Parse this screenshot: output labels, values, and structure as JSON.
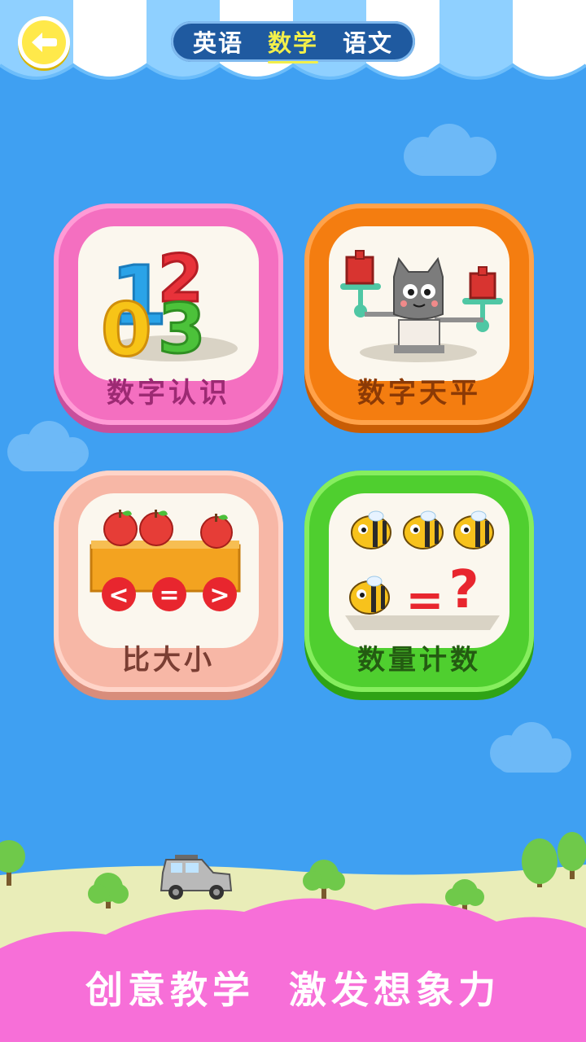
{
  "nav": {
    "tabs": [
      {
        "label": "英语",
        "active": false
      },
      {
        "label": "数学",
        "active": true
      },
      {
        "label": "语文",
        "active": false
      }
    ]
  },
  "cards": [
    {
      "id": "number-recognition",
      "label": "数字认识",
      "digits": [
        "1",
        "2",
        "0",
        "3"
      ]
    },
    {
      "id": "number-balance",
      "label": "数字天平"
    },
    {
      "id": "compare-size",
      "label": "比大小",
      "symbols": [
        "<",
        "=",
        ">"
      ]
    },
    {
      "id": "quantity-count",
      "label": "数量计数",
      "symbols": [
        "=",
        "?"
      ]
    }
  ],
  "slogan": "创意教学  激发想象力",
  "colors": {
    "sky": "#3fa0f2",
    "accent_yellow": "#f2ef4a",
    "bottom_pink": "#f76fd8"
  }
}
